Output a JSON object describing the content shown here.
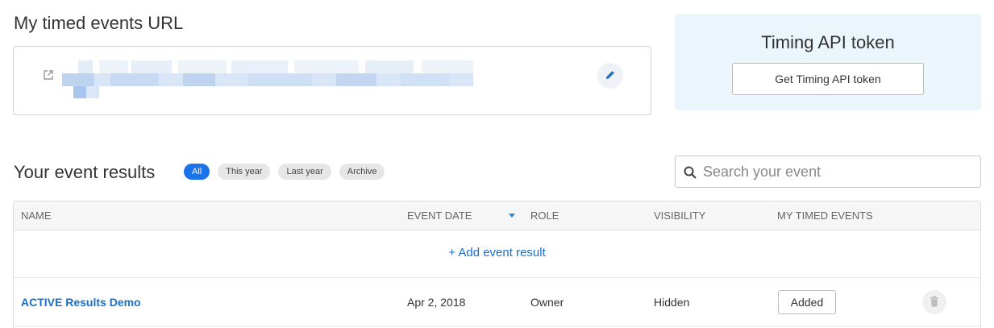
{
  "url_section": {
    "title": "My timed events URL",
    "edit_icon": "pencil-icon",
    "link_icon": "external-link-icon"
  },
  "token_section": {
    "title": "Timing API token",
    "button_label": "Get Timing API token"
  },
  "results_section": {
    "title": "Your event results",
    "filters": [
      {
        "label": "All",
        "active": true
      },
      {
        "label": "This year",
        "active": false
      },
      {
        "label": "Last year",
        "active": false
      },
      {
        "label": "Archive",
        "active": false
      }
    ],
    "search_placeholder": "Search your event"
  },
  "table": {
    "headers": {
      "name": "NAME",
      "event_date": "EVENT DATE",
      "role": "ROLE",
      "visibility": "VISIBILITY",
      "my_timed_events": "MY TIMED EVENTS"
    },
    "add_label": "+ Add event result",
    "rows": [
      {
        "name": "ACTIVE Results Demo",
        "event_date": "Apr 2, 2018",
        "role": "Owner",
        "visibility": "Hidden",
        "timed_events_label": "Added"
      }
    ]
  },
  "colors": {
    "accent": "#1a73e8",
    "link": "#1a6fc9",
    "token_bg": "#eaf5fc"
  }
}
